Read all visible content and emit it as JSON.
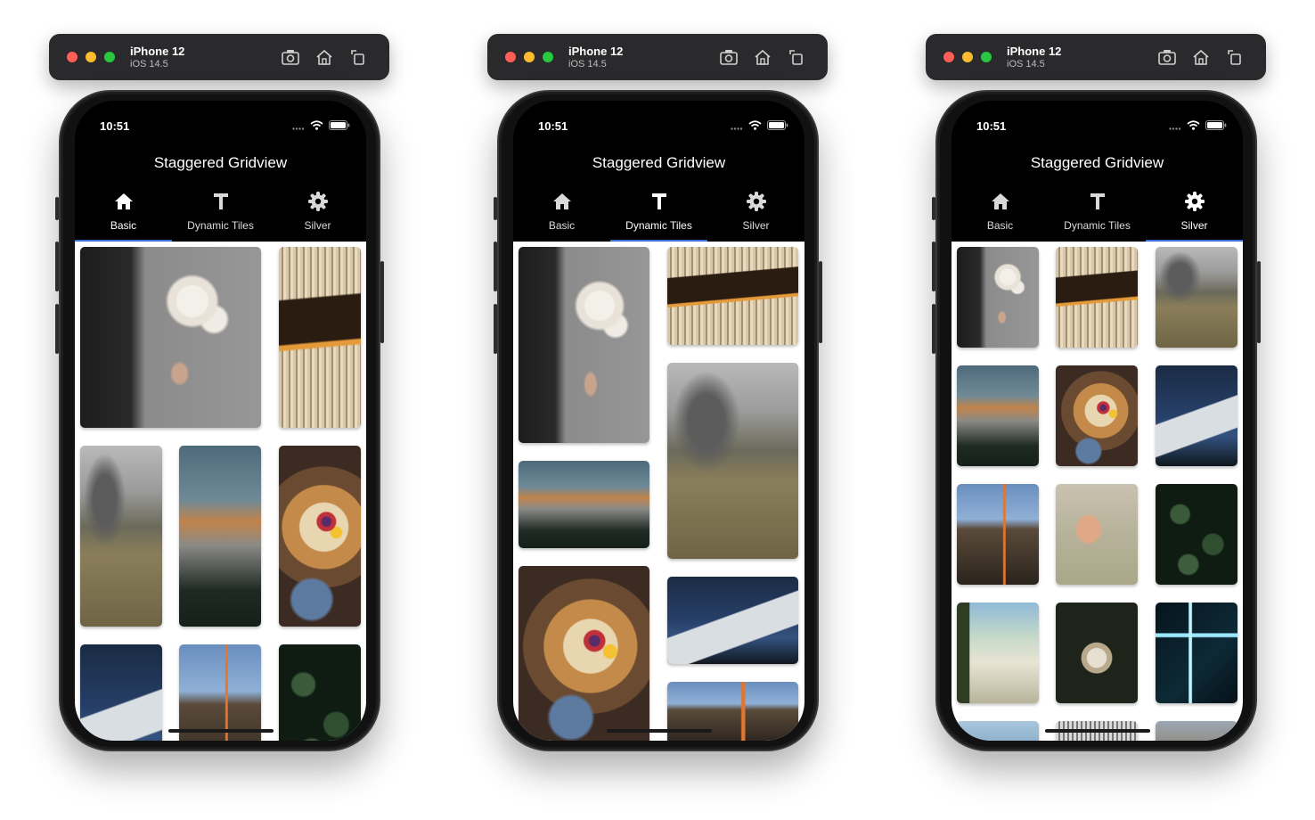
{
  "devices": [
    {
      "window": {
        "device_name": "iPhone 12",
        "os_version": "iOS 14.5"
      },
      "status": {
        "time": "10:51"
      },
      "appbar_title": "Staggered Gridview",
      "tabs": [
        {
          "label": "Basic",
          "icon": "home-icon"
        },
        {
          "label": "Dynamic Tiles",
          "icon": "text-t-icon"
        },
        {
          "label": "Silver",
          "icon": "gear-icon"
        }
      ],
      "active_tab": "Basic",
      "accent_color": "#3b6fd6"
    },
    {
      "window": {
        "device_name": "iPhone 12",
        "os_version": "iOS 14.5"
      },
      "status": {
        "time": "10:51"
      },
      "appbar_title": "Staggered Gridview",
      "tabs": [
        {
          "label": "Basic",
          "icon": "home-icon"
        },
        {
          "label": "Dynamic Tiles",
          "icon": "text-t-icon"
        },
        {
          "label": "Silver",
          "icon": "gear-icon"
        }
      ],
      "active_tab": "Dynamic Tiles",
      "accent_color": "#3b6fd6"
    },
    {
      "window": {
        "device_name": "iPhone 12",
        "os_version": "iOS 14.5"
      },
      "status": {
        "time": "10:51"
      },
      "appbar_title": "Staggered Gridview",
      "tabs": [
        {
          "label": "Basic",
          "icon": "home-icon"
        },
        {
          "label": "Dynamic Tiles",
          "icon": "text-t-icon"
        },
        {
          "label": "Silver",
          "icon": "gear-icon"
        }
      ],
      "active_tab": "Silver",
      "accent_color": "#3b6fd6"
    }
  ],
  "colors": {
    "traffic_close": "#ff5f57",
    "traffic_min": "#febc2e",
    "traffic_max": "#28c840",
    "titlebar": "#2a2a2c",
    "appbar": "#000000",
    "grid_bg": "#ffffff"
  }
}
